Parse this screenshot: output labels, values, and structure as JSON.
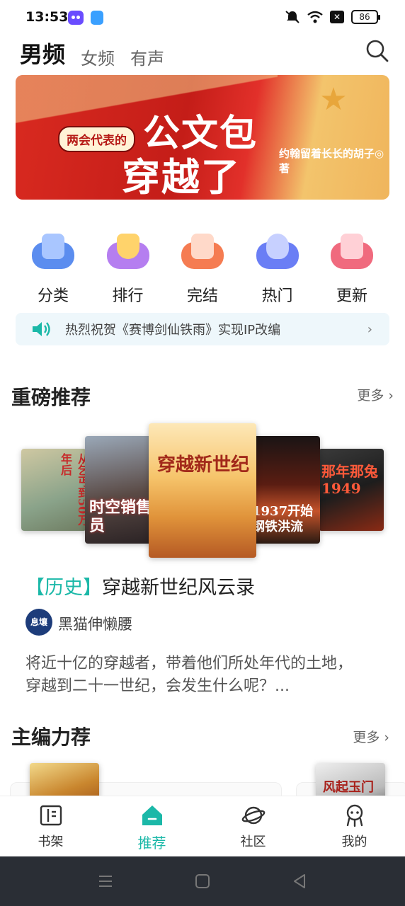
{
  "status": {
    "time": "13:53",
    "battery": "86",
    "x_badge": "✕"
  },
  "top_tabs": [
    {
      "label": "男频",
      "active": true
    },
    {
      "label": "女频",
      "active": false
    },
    {
      "label": "有声",
      "active": false
    }
  ],
  "banner": {
    "tag": "两会代表的",
    "title_line1": "公文包",
    "title_line2": "穿越了",
    "author": "约翰留着长长的胡子◎著"
  },
  "categories": [
    {
      "label": "分类",
      "icon": "category-icon",
      "color": "#5b8def"
    },
    {
      "label": "排行",
      "icon": "trophy-icon",
      "color": "#b57ef0"
    },
    {
      "label": "完结",
      "icon": "completed-icon",
      "color": "#f57c52"
    },
    {
      "label": "热门",
      "icon": "flame-icon",
      "color": "#6a7ef5"
    },
    {
      "label": "更新",
      "icon": "update-icon",
      "color": "#f06a7e"
    }
  ],
  "notice": {
    "text": "热烈祝贺《赛博剑仙铁雨》实现IP改编"
  },
  "featured": {
    "title": "重磅推荐",
    "more": "更多",
    "covers": [
      {
        "text": "从乞丐到50万年后"
      },
      {
        "text": "时空销售员"
      },
      {
        "text": "穿越新世纪"
      },
      {
        "text": "1937开始钢铁洪流"
      },
      {
        "text": "那年那兔1949"
      }
    ],
    "book": {
      "genre": "【历史】",
      "name": "穿越新世纪风云录",
      "author": "黑猫伸懒腰",
      "avatar_text": "息壤",
      "description": "将近十亿的穿越者，带着他们所处年代的土地，穿越到二十一世纪，会发生什么呢？..."
    }
  },
  "editor_pick": {
    "title": "主编力荐",
    "more": "更多",
    "cover_right": "风起玉门"
  },
  "bottom_nav": [
    {
      "label": "书架",
      "icon": "bookshelf-icon",
      "active": false
    },
    {
      "label": "推荐",
      "icon": "recommend-icon",
      "active": true
    },
    {
      "label": "社区",
      "icon": "community-icon",
      "active": false
    },
    {
      "label": "我的",
      "icon": "profile-icon",
      "active": false
    }
  ]
}
